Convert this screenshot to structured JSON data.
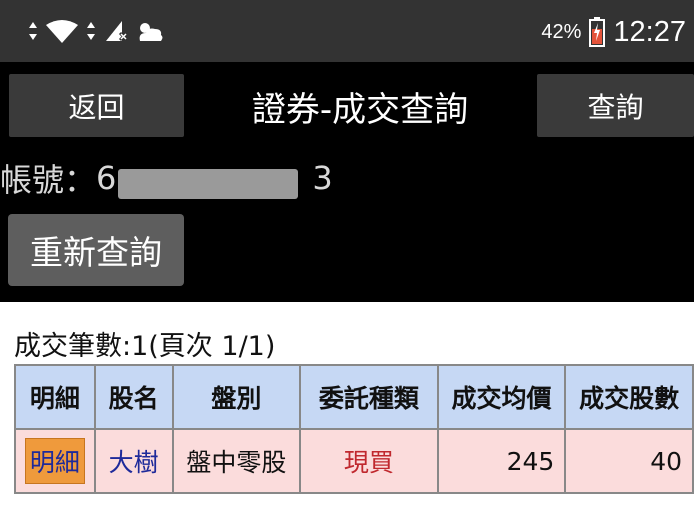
{
  "status_bar": {
    "battery_percent": "42%",
    "time": "12:27",
    "icons": [
      "data-arrows-icon",
      "wifi-icon",
      "data-arrows-icon",
      "signal-no-sim-icon",
      "weather-cloud-icon",
      "battery-charging-icon"
    ]
  },
  "header": {
    "back_label": "返回",
    "title": "證券-成交查詢",
    "query_label": "查詢",
    "account_label": "帳號：",
    "account_prefix": "6",
    "account_suffix": "3",
    "requery_label": "重新查詢"
  },
  "summary": {
    "count_text": "成交筆數:1(頁次 1/1)"
  },
  "table": {
    "headers": [
      "明細",
      "股名",
      "盤別",
      "委託種類",
      "成交均價",
      "成交股數"
    ],
    "rows": [
      {
        "detail": "明細",
        "stock": "大樹",
        "session": "盤中零股",
        "order_type": "現買",
        "avg_price": "245",
        "shares": "40"
      }
    ]
  },
  "colors": {
    "status_bg": "#333333",
    "header_bg": "#000000",
    "table_header_bg": "#c6d8f4",
    "table_row_bg": "#fbdcdc",
    "link_blue": "#1e2a9a",
    "buy_red": "#c0282e",
    "detail_orange": "#ef9a3c"
  }
}
